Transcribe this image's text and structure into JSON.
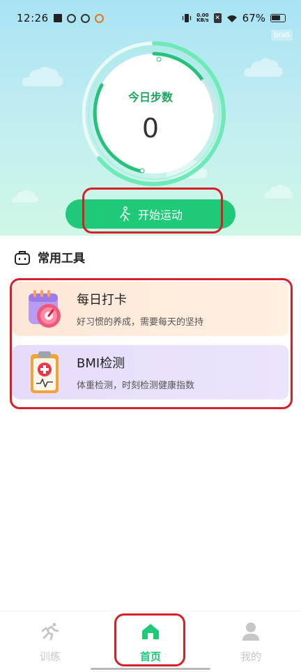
{
  "status_bar": {
    "time": "12:26",
    "net_speed_value": "0.00",
    "net_speed_unit": "KB/s",
    "battery": "67%"
  },
  "badge": "bra6",
  "steps": {
    "label": "今日步数",
    "value": "0"
  },
  "start_button": {
    "label": "开始运动",
    "icon": "walking-person-icon"
  },
  "tools": {
    "title": "常用工具",
    "icon": "toolbox-icon",
    "items": [
      {
        "title": "每日打卡",
        "subtitle": "好习惯的养成，需要每天的坚持",
        "icon": "calendar-checkin-icon"
      },
      {
        "title": "BMI检测",
        "subtitle": "体重检测，时刻检测健康指数",
        "icon": "medical-clipboard-icon"
      }
    ]
  },
  "tabs": [
    {
      "label": "训练",
      "icon": "running-icon",
      "active": false
    },
    {
      "label": "首页",
      "icon": "home-icon",
      "active": true
    },
    {
      "label": "我的",
      "icon": "user-icon",
      "active": false
    }
  ],
  "colors": {
    "accent_green": "#1ec978",
    "highlight_red": "#d61f26",
    "checkin_card_bg": "#fde7d6",
    "bmi_card_bg": "#e6dcfa"
  }
}
